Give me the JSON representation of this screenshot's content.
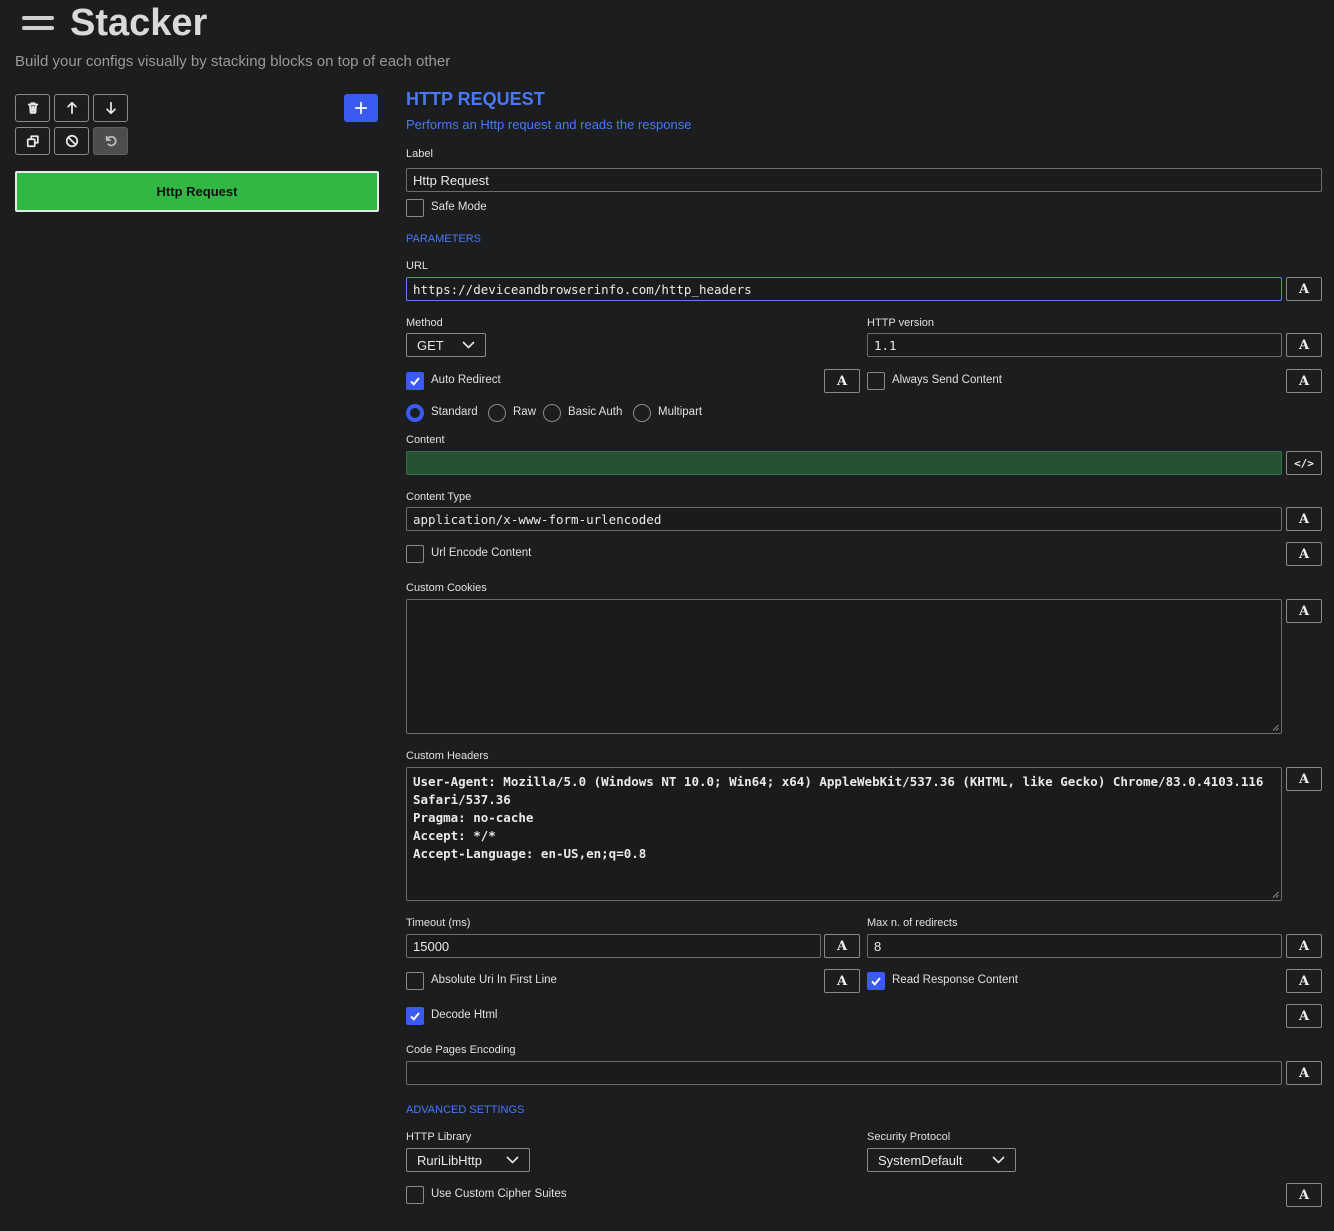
{
  "app": {
    "title": "Stacker",
    "subtitle": "Build your configs visually by stacking blocks on top of each other"
  },
  "toolbar": {
    "icons": [
      "trash-icon",
      "arrow-up-icon",
      "arrow-down-icon",
      "clone-icon",
      "disable-icon",
      "undo-icon",
      "plus-icon"
    ]
  },
  "stack": {
    "blocks": [
      {
        "label": "Http Request",
        "color": "#30b843"
      }
    ]
  },
  "block_settings": {
    "title": "HTTP REQUEST",
    "description": "Performs an Http request and reads the response",
    "label_label": "Label",
    "label_value": "Http Request",
    "safe_mode_label": "Safe Mode",
    "safe_mode_checked": false,
    "parameters_heading": "PARAMETERS",
    "url_label": "URL",
    "url_value": "https://deviceandbrowserinfo.com/http_headers",
    "method_label": "Method",
    "method_value": "GET",
    "http_version_label": "HTTP version",
    "http_version_value": "1.1",
    "auto_redirect_label": "Auto Redirect",
    "auto_redirect_checked": true,
    "always_send_content_label": "Always Send Content",
    "always_send_content_checked": false,
    "content_modes": [
      {
        "label": "Standard",
        "selected": true
      },
      {
        "label": "Raw",
        "selected": false
      },
      {
        "label": "Basic Auth",
        "selected": false
      },
      {
        "label": "Multipart",
        "selected": false
      }
    ],
    "content_label": "Content",
    "content_value": "",
    "content_type_label": "Content Type",
    "content_type_value": "application/x-www-form-urlencoded",
    "url_encode_label": "Url Encode Content",
    "url_encode_checked": false,
    "custom_cookies_label": "Custom Cookies",
    "custom_cookies_value": "",
    "custom_headers_label": "Custom Headers",
    "custom_headers_lines": [
      "User-Agent: Mozilla/5.0 (Windows NT 10.0; Win64; x64) AppleWebKit/537.36 (KHTML, like Gecko) Chrome/83.0.4103.116",
      "Safari/537.36",
      "Pragma: no-cache",
      "Accept: */*",
      "Accept-Language: en-US,en;q=0.8"
    ],
    "timeout_label": "Timeout (ms)",
    "timeout_value": "15000",
    "max_redirects_label": "Max n. of redirects",
    "max_redirects_value": "8",
    "absolute_uri_label": "Absolute Uri In First Line",
    "absolute_uri_checked": false,
    "read_response_label": "Read Response Content",
    "read_response_checked": true,
    "decode_html_label": "Decode Html",
    "decode_html_checked": true,
    "code_pages_label": "Code Pages Encoding",
    "code_pages_value": "",
    "advanced_heading": "ADVANCED SETTINGS",
    "http_library_label": "HTTP Library",
    "http_library_value": "RuriLibHttp",
    "security_protocol_label": "Security Protocol",
    "security_protocol_value": "SystemDefault",
    "cipher_suites_label": "Use Custom Cipher Suites",
    "cipher_suites_checked": false,
    "variable_button_glyph": "A",
    "code_button_glyph": "</>"
  },
  "colors": {
    "accent": "#3b5bf0",
    "heading": "#4a79f7",
    "block_green": "#30b843",
    "content_green": "#245233",
    "background": "#1c1d1f"
  }
}
